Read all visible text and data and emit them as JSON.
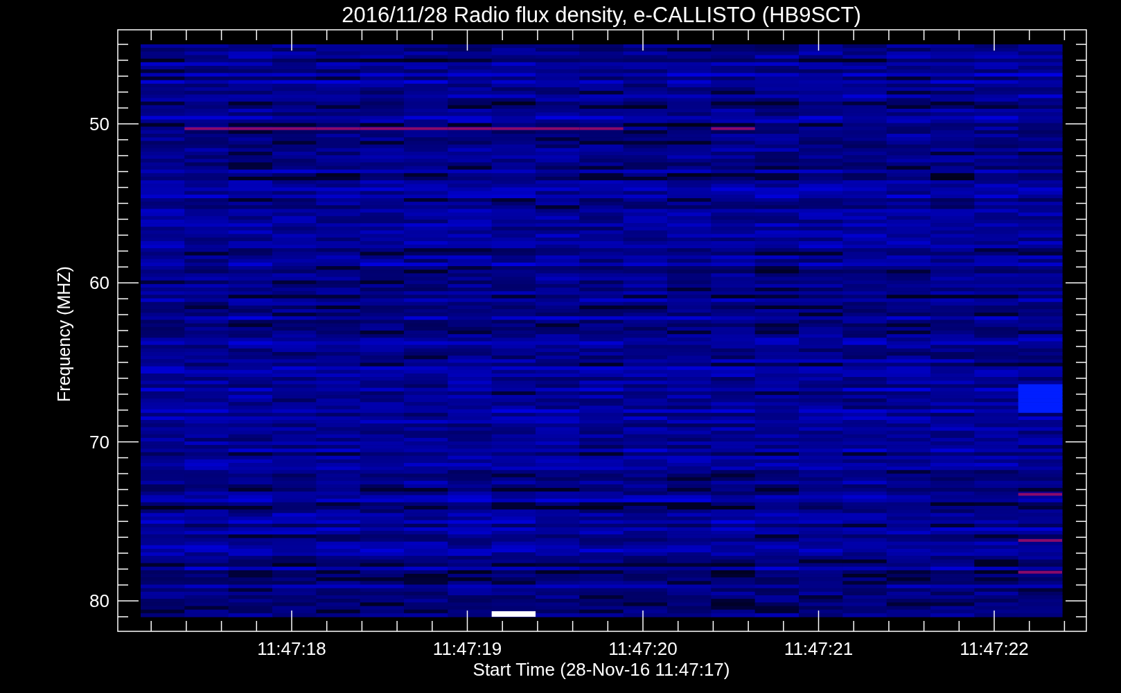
{
  "plot": {
    "title": "2016/11/28  Radio flux density, e-CALLISTO (HB9SCT)",
    "y_axis": {
      "label": "Frequency (MHZ)",
      "ticks": [
        "50",
        "60",
        "70",
        "80"
      ]
    },
    "x_axis": {
      "label": "Start Time (28-Nov-16 11:47:17)",
      "ticks": [
        "11:47:18",
        "11:47:19",
        "11:47:20",
        "11:47:21",
        "11:47:22"
      ]
    }
  }
}
